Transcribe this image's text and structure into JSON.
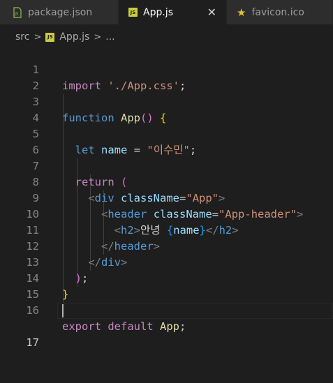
{
  "tabs": [
    {
      "label": "package.json",
      "icon": "json-file-icon"
    },
    {
      "label": "App.js",
      "icon": "js-file-icon",
      "active": true,
      "close": "✕"
    },
    {
      "label": "favicon.ico",
      "icon": "star-icon"
    }
  ],
  "breadcrumb": {
    "folder": "src",
    "file": "App.js",
    "more": "..."
  },
  "file_badge": "JS",
  "editor": {
    "line_numbers": [
      "1",
      "2",
      "3",
      "4",
      "5",
      "6",
      "7",
      "8",
      "9",
      "10",
      "11",
      "12",
      "13",
      "14",
      "15",
      "16",
      "17"
    ],
    "current_line": "17",
    "code": {
      "l1": {
        "kw": "import",
        "str": "'./App.css'",
        "end": ";"
      },
      "l3": {
        "kw": "function",
        "fn": "App",
        "paren": "()",
        "brace": "{"
      },
      "l5": {
        "kw": "let",
        "var": "name",
        "eq": "=",
        "str": "\"이수민\"",
        "end": ";"
      },
      "l7": {
        "kw": "return",
        "paren": "("
      },
      "l8": {
        "open": "<",
        "tag": "div",
        "attr": "className",
        "eq": "=",
        "str": "\"App\"",
        "close": ">"
      },
      "l9": {
        "open": "<",
        "tag": "header",
        "attr": "className",
        "eq": "=",
        "str": "\"App-header\"",
        "close": ">"
      },
      "l10": {
        "open": "<",
        "tag": "h2",
        "close": ">",
        "text": "안녕 ",
        "lbrace": "{",
        "var": "name",
        "rbrace": "}",
        "open2": "</",
        "tag2": "h2",
        "close2": ">"
      },
      "l11": {
        "open": "</",
        "tag": "header",
        "close": ">"
      },
      "l12": {
        "open": "</",
        "tag": "div",
        "close": ">"
      },
      "l13": {
        "paren": ")",
        "end": ";"
      },
      "l14": {
        "brace": "}"
      },
      "l16": {
        "kw": "export",
        "kw2": "default",
        "var": "App",
        "end": ";"
      }
    }
  }
}
